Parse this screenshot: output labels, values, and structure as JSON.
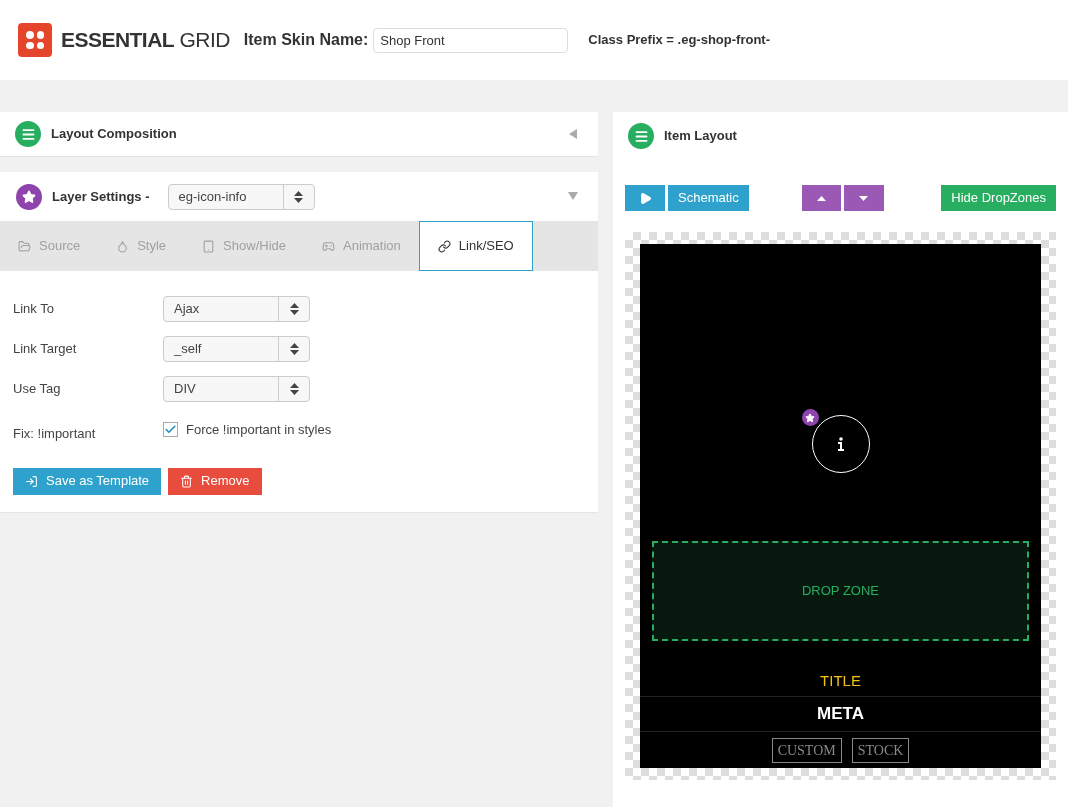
{
  "header": {
    "logo_bold": "ESSENTIAL",
    "logo_light": "GRID",
    "skin_name_label": "Item Skin Name:",
    "skin_name_value": "Shop Front",
    "class_prefix": "Class Prefix = .eg-shop-front-"
  },
  "layout_composition": {
    "title": "Layout Composition",
    "expanded": false
  },
  "layer_settings": {
    "title": "Layer Settings -",
    "layer": "eg-icon-info",
    "expanded": true,
    "tabs": [
      {
        "label": "Source",
        "selected": false
      },
      {
        "label": "Style",
        "selected": false
      },
      {
        "label": "Show/Hide",
        "selected": false
      },
      {
        "label": "Animation",
        "selected": false
      },
      {
        "label": "Link/SEO",
        "selected": true
      }
    ],
    "fields": [
      {
        "kind": "select",
        "label": "Link To",
        "value": "Ajax"
      },
      {
        "kind": "select",
        "label": "Link Target",
        "value": "_self"
      },
      {
        "kind": "select",
        "label": "Use Tag",
        "value": "DIV"
      },
      {
        "kind": "checkbox",
        "label": "Fix: !important",
        "text": "Force !important in styles",
        "checked": true
      }
    ],
    "buttons": [
      {
        "kind": "save",
        "label": "Save as Template"
      },
      {
        "kind": "remove",
        "label": "Remove"
      }
    ]
  },
  "item_layout": {
    "title": "Item Layout",
    "schematic": "Schematic",
    "hide_dropzones": "Hide DropZones",
    "preview": {
      "drop_zone": "DROP ZONE",
      "title": "TITLE",
      "meta": "META",
      "tags": [
        "CUSTOM",
        "STOCK"
      ]
    }
  }
}
